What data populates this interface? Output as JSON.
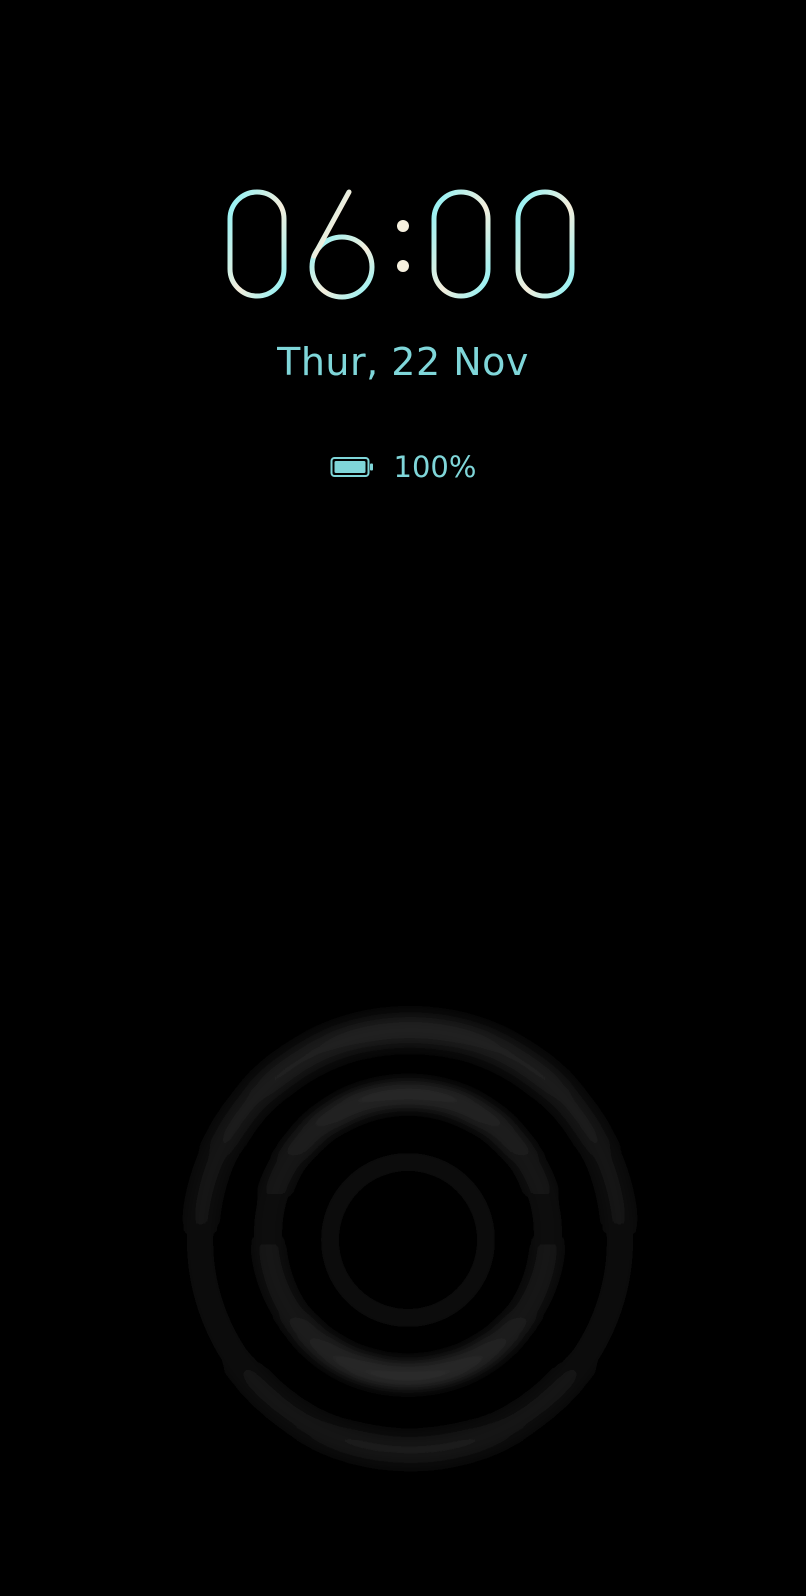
{
  "clock": {
    "digits": [
      "0",
      "6",
      "0",
      "0"
    ],
    "gradient": [
      "#8af2f7",
      "#f4eedc",
      "#8af2f7"
    ]
  },
  "date": {
    "text": "Thur, 22 Nov"
  },
  "battery": {
    "icon": "battery-full-icon",
    "level_text": "100%",
    "color": "#7fd6d9"
  },
  "unlock": {
    "icon": "fingerprint-ripple-icon"
  }
}
